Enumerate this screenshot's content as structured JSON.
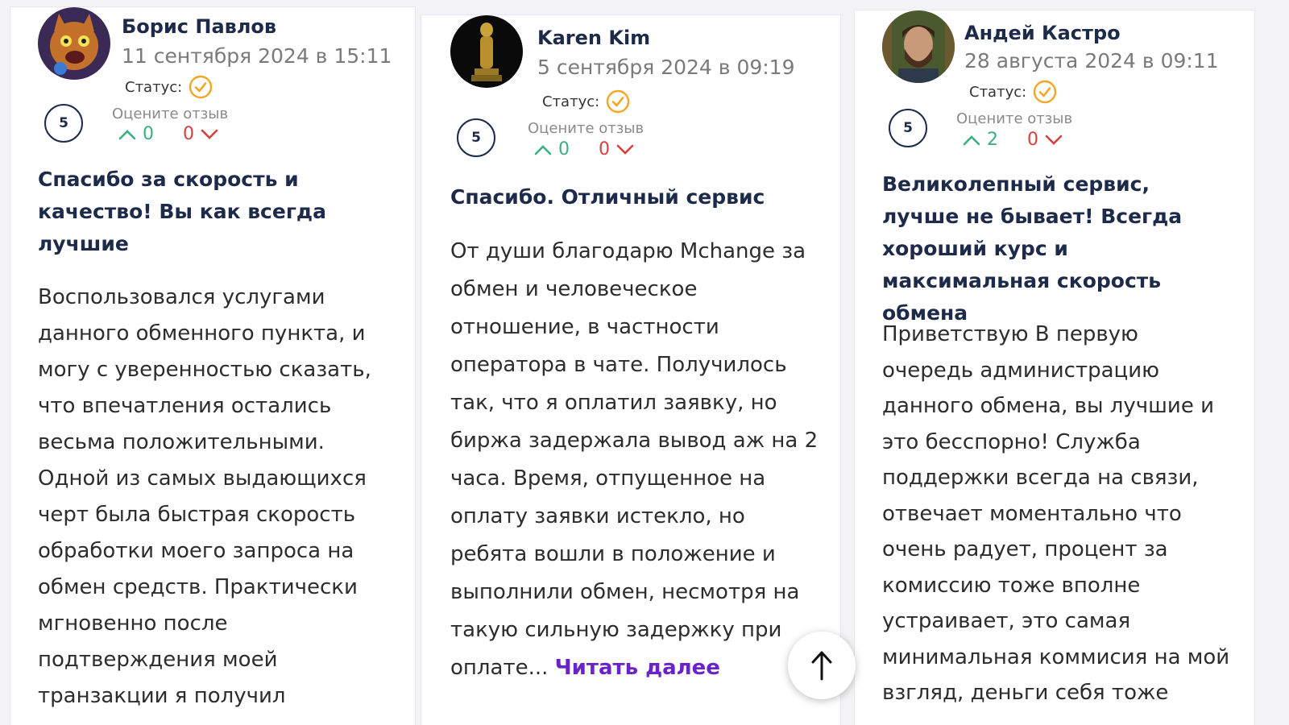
{
  "reviews": [
    {
      "author": "Борис Павлов",
      "date": "11 сентября 2024 в 15:11",
      "status_label": "Статус:",
      "rating": "5",
      "rate_label": "Оцените отзыв",
      "likes": "0",
      "dislikes": "0",
      "title": "Спасибо за скорость и качество! Вы как всегда лучшие",
      "text": "Воспользовался услугами данного обменного пункта, и могу с уверенностью сказать, что впечатления остались весьма положительными. Одной из самых выдающихся черт была быстрая скорость обработки моего запроса на обмен средств. Практически мгновенно после подтверждения моей транзакции я получил"
    },
    {
      "author": "Karen Kim",
      "date": "5 сентября 2024 в 09:19",
      "status_label": "Статус:",
      "rating": "5",
      "rate_label": "Оцените отзыв",
      "likes": "0",
      "dislikes": "0",
      "title": "Спасибо. Отличный сервис",
      "text": "От души благодарю Mchange за обмен и человеческое отношение, в частности оператора в чате. Получилось так, что я оплатил заявку, но биржа задержала вывод аж на 2 часа. Время, отпущенное на оплату заявки истекло, но ребята вошли в положение и выполнили обмен, несмотря на такую сильную задержку при оплате...",
      "read_more": "Читать далее"
    },
    {
      "author": "Андей Кастро",
      "date": "28 августа 2024 в 09:11",
      "status_label": "Статус:",
      "rating": "5",
      "rate_label": "Оцените отзыв",
      "likes": "2",
      "dislikes": "0",
      "title": "Великолепный сервис, лучше не бывает! Всегда хороший курс и максимальная скорость обмена",
      "text": "Приветствую В первую очередь администрацию данного обмена, вы лучшие и это бесспорно! Служба поддержки всегда на связи, отвечает моментально что очень радует, процент за комиссию тоже вполне устраивает, это самая минимальная коммисия на мой взгляд, деньги себя тоже"
    }
  ],
  "icons": {
    "status": "check-circle-icon",
    "vote_up": "chevron-up-icon",
    "vote_down": "chevron-down-icon",
    "scroll_top": "arrow-up-icon"
  },
  "colors": {
    "heading": "#1e2a4a",
    "status_check": "#f5a524",
    "vote_up": "#3bb07e",
    "vote_down": "#d64040",
    "read_more": "#6a22c9"
  }
}
